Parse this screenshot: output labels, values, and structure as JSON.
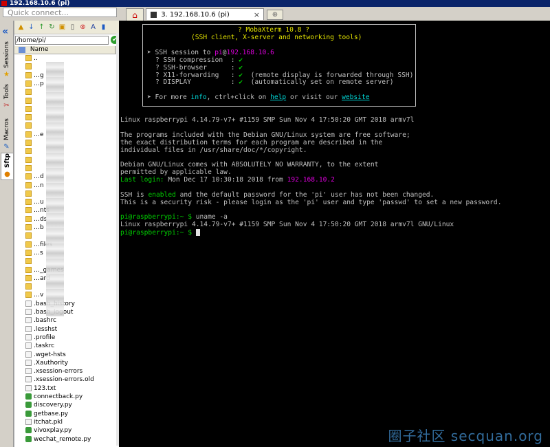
{
  "window": {
    "title": "192.168.10.6 (pi)"
  },
  "quick_connect": {
    "placeholder": "Quick connect..."
  },
  "tabs": {
    "session_label": "3. 192.168.10.6 (pi)",
    "close_glyph": "×"
  },
  "side_tabs": {
    "sessions": "Sessions",
    "tools": "Tools",
    "macros": "Macros",
    "sftp": "Sftp"
  },
  "sftp": {
    "path": "/home/pi/",
    "column_name": "Name",
    "files": [
      {
        "name": "..",
        "type": "folder"
      },
      {
        "name": "",
        "type": "folder"
      },
      {
        "name": "…g",
        "type": "folder"
      },
      {
        "name": "…p",
        "type": "folder"
      },
      {
        "name": "",
        "type": "folder"
      },
      {
        "name": "",
        "type": "folder"
      },
      {
        "name": "",
        "type": "folder"
      },
      {
        "name": "",
        "type": "folder"
      },
      {
        "name": "",
        "type": "folder"
      },
      {
        "name": "…e",
        "type": "folder"
      },
      {
        "name": "",
        "type": "folder"
      },
      {
        "name": "",
        "type": "folder"
      },
      {
        "name": "",
        "type": "folder"
      },
      {
        "name": "",
        "type": "folder"
      },
      {
        "name": "…d",
        "type": "folder"
      },
      {
        "name": "…n",
        "type": "folder"
      },
      {
        "name": "",
        "type": "folder"
      },
      {
        "name": "…u",
        "type": "folder"
      },
      {
        "name": "…nts",
        "type": "folder"
      },
      {
        "name": "…ds",
        "type": "folder"
      },
      {
        "name": "…b",
        "type": "folder"
      },
      {
        "name": "",
        "type": "folder"
      },
      {
        "name": "…files",
        "type": "folder"
      },
      {
        "name": "…s",
        "type": "folder"
      },
      {
        "name": "",
        "type": "folder"
      },
      {
        "name": "…_games",
        "type": "folder"
      },
      {
        "name": "…ard",
        "type": "folder"
      },
      {
        "name": "",
        "type": "folder"
      },
      {
        "name": "…v",
        "type": "folder"
      },
      {
        "name": ".bash_history",
        "type": "doc"
      },
      {
        "name": ".bash_logout",
        "type": "doc"
      },
      {
        "name": ".bashrc",
        "type": "doc"
      },
      {
        "name": ".lesshst",
        "type": "doc"
      },
      {
        "name": ".profile",
        "type": "doc"
      },
      {
        "name": ".taskrc",
        "type": "doc"
      },
      {
        "name": ".wget-hsts",
        "type": "doc"
      },
      {
        "name": ".Xauthority",
        "type": "doc"
      },
      {
        "name": ".xsession-errors",
        "type": "doc"
      },
      {
        "name": ".xsession-errors.old",
        "type": "doc"
      },
      {
        "name": "123.txt",
        "type": "doc"
      },
      {
        "name": "connectback.py",
        "type": "py"
      },
      {
        "name": "discovery.py",
        "type": "py"
      },
      {
        "name": "getbase.py",
        "type": "py"
      },
      {
        "name": "itchat.pkl",
        "type": "doc"
      },
      {
        "name": "vivoxplay.py",
        "type": "py"
      },
      {
        "name": "wechat_remote.py",
        "type": "py"
      }
    ]
  },
  "banner": {
    "title": "? MobaXterm 10.8 ?",
    "subtitle": "(SSH client, X-server and networking tools)",
    "ssh_prefix": "➤ SSH session to ",
    "ssh_user": "pi",
    "ssh_at": "@",
    "ssh_host": "192.168.10.6",
    "rows": [
      {
        "label": "? SSH compression  : ",
        "mark": "✔",
        "note": ""
      },
      {
        "label": "? SSH-browser      : ",
        "mark": "✔",
        "note": ""
      },
      {
        "label": "? X11-forwarding   : ",
        "mark": "✔",
        "note": "  (remote display is forwarded through SSH)"
      },
      {
        "label": "? DISPLAY          : ",
        "mark": "✔",
        "note": "  (automatically set on remote server)"
      }
    ],
    "more_prefix": "➤ For more ",
    "more_info": "info",
    "more_mid": ", ctrl+click on ",
    "more_help": "help",
    "more_or": " or visit our ",
    "more_website": "website"
  },
  "terminal": {
    "uname_line": "Linux raspberrypi 4.14.79-v7+ #1159 SMP Sun Nov 4 17:50:20 GMT 2018 armv7l",
    "motd1": "The programs included with the Debian GNU/Linux system are free software;",
    "motd2": "the exact distribution terms for each program are described in the",
    "motd3": "individual files in /usr/share/doc/*/copyright.",
    "motd4": "Debian GNU/Linux comes with ABSOLUTELY NO WARRANTY, to the extent",
    "motd5": "permitted by applicable law.",
    "lastlogin_label": "Last login:",
    "lastlogin_text": " Mon Dec 17 10:30:18 2018 from ",
    "lastlogin_ip": "192.168.10.2",
    "ssh_warn_a": "SSH is ",
    "ssh_warn_enabled": "enabled",
    "ssh_warn_b": " and the default password for the 'pi' user has not been changed.",
    "ssh_warn2": "This is a security risk - please login as the 'pi' user and type 'passwd' to set a new password.",
    "prompt": "pi@raspberrypi:~ $",
    "command1": " uname -a",
    "uname_output": "Linux raspberrypi 4.14.79-v7+ #1159 SMP Sun Nov 4 17:50:20 GMT 2018 armv7l GNU/Linux"
  },
  "watermark": "圈子社区 secquan.org",
  "colors": {
    "prompt_green": "#00d000",
    "link_cyan": "#00d8d8",
    "host_magenta": "#e000e0",
    "title_yellow": "#e5e500"
  }
}
